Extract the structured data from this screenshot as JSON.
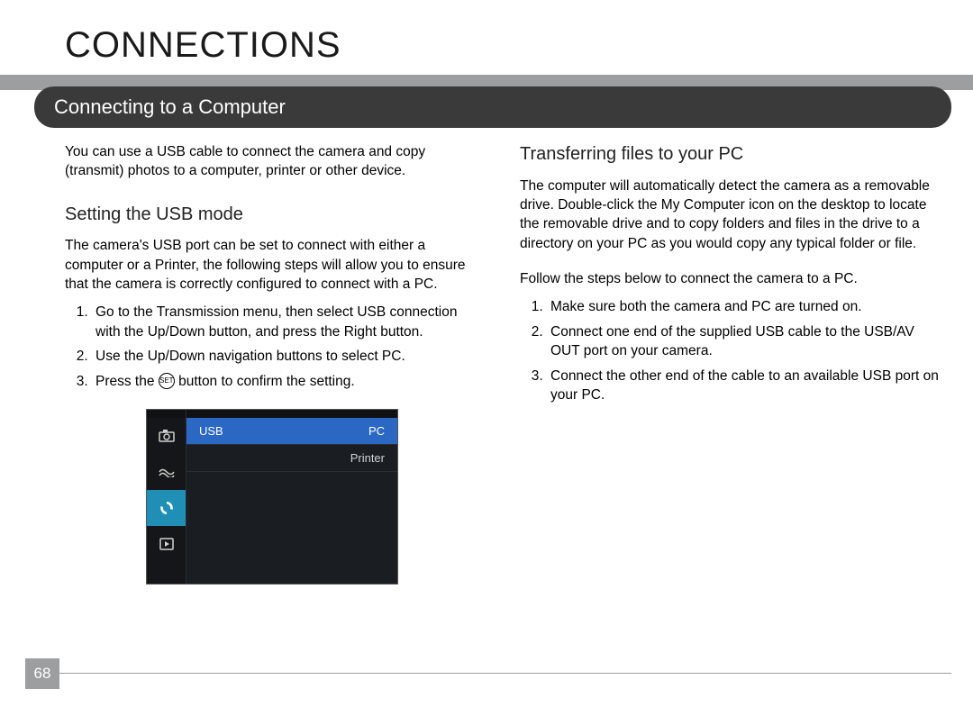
{
  "page_title": "CONNECTIONS",
  "section_title": "Connecting to a Computer",
  "page_number": "68",
  "left": {
    "intro": "You can use a USB cable to connect the camera and copy (transmit) photos to a computer, printer or other device.",
    "sub1": "Setting the USB mode",
    "sub1_p": "The camera's USB port can be set to connect with either a computer or a Printer, the following steps will allow you to ensure that the camera is correctly configured to connect with a PC.",
    "sub1_li1": "Go to the Transmission menu, then select USB connection with the Up/Down button, and press the Right button.",
    "sub1_li2": "Use the Up/Down navigation buttons to select PC.",
    "sub1_li3a": "Press the ",
    "sub1_li3_btn": "SET",
    "sub1_li3b": " button to confirm the setting."
  },
  "right": {
    "sub2": "Transferring files to your PC",
    "sub2_p": "The computer will automatically detect the camera as a removable drive. Double-click the My Computer icon on the desktop to locate the removable drive and to copy folders and files in the drive to a directory on your PC as you would copy any typical folder or file.",
    "follow": "Follow the steps below to connect the camera to a PC.",
    "li1": "Make sure both the camera and PC are turned on.",
    "li2": "Connect one end of the supplied USB cable to the USB/AV OUT port on your camera.",
    "li3": "Connect the other end of the cable to an available USB port on your PC."
  },
  "menu": {
    "row1_left": "USB",
    "row1_right": "PC",
    "row2_right": "Printer"
  }
}
